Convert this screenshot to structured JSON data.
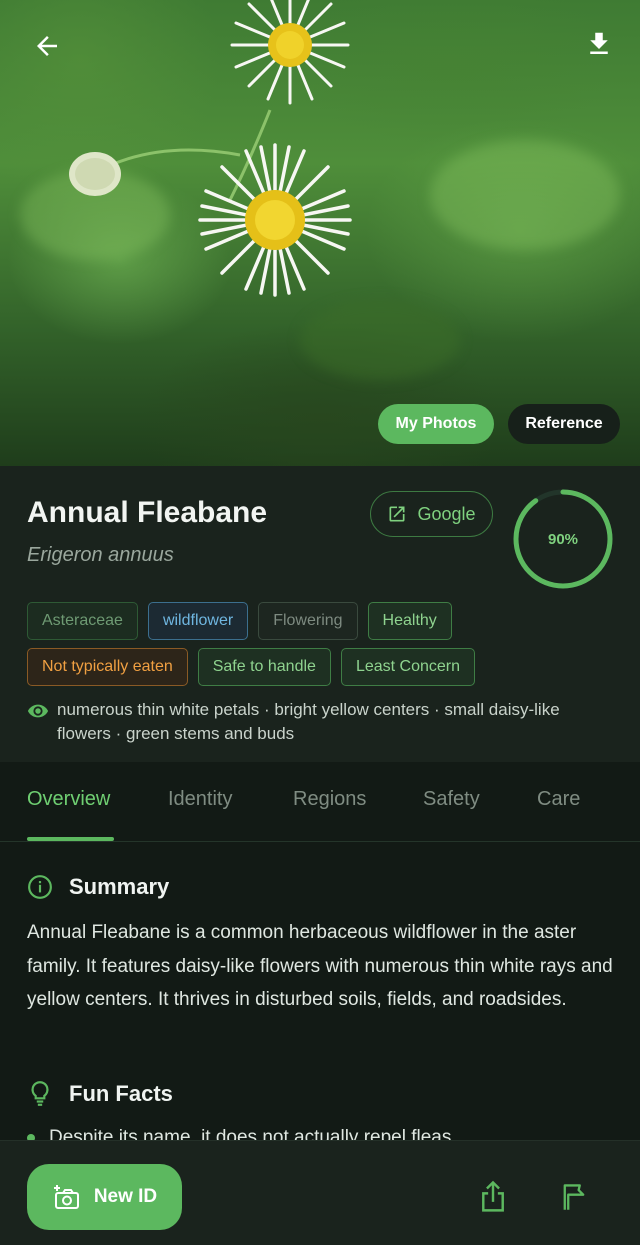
{
  "hero": {
    "photo_tabs": [
      "My Photos",
      "Reference"
    ]
  },
  "species": {
    "common_name": "Annual Fleabane",
    "scientific_name": "Erigeron annuus",
    "google_label": "Google",
    "confidence_label": "90%",
    "confidence": 0.9
  },
  "tags": {
    "row1": [
      "Asteraceae",
      "wildflower",
      "Flowering",
      "Healthy"
    ],
    "row2": [
      "Not typically eaten",
      "Safe to handle",
      "Least Concern"
    ]
  },
  "features_text": "numerous thin white petals · bright yellow centers · small daisy-like flowers · green stems and buds",
  "tabs": [
    "Overview",
    "Identity",
    "Regions",
    "Safety",
    "Care"
  ],
  "summary": {
    "heading": "Summary",
    "text": "Annual Fleabane is a common herbaceous wildflower in the aster family. It features daisy-like flowers with numerous thin white rays and yellow centers. It thrives in disturbed soils, fields, and roadsides."
  },
  "fun_facts": {
    "heading": "Fun Facts",
    "items": [
      "Despite its name, it does not actually repel fleas."
    ]
  },
  "bottom_bar": {
    "new_id_label": "New ID"
  },
  "colors": {
    "accent": "#5cb85f",
    "background": "#121a15",
    "surface": "#1a231d"
  }
}
